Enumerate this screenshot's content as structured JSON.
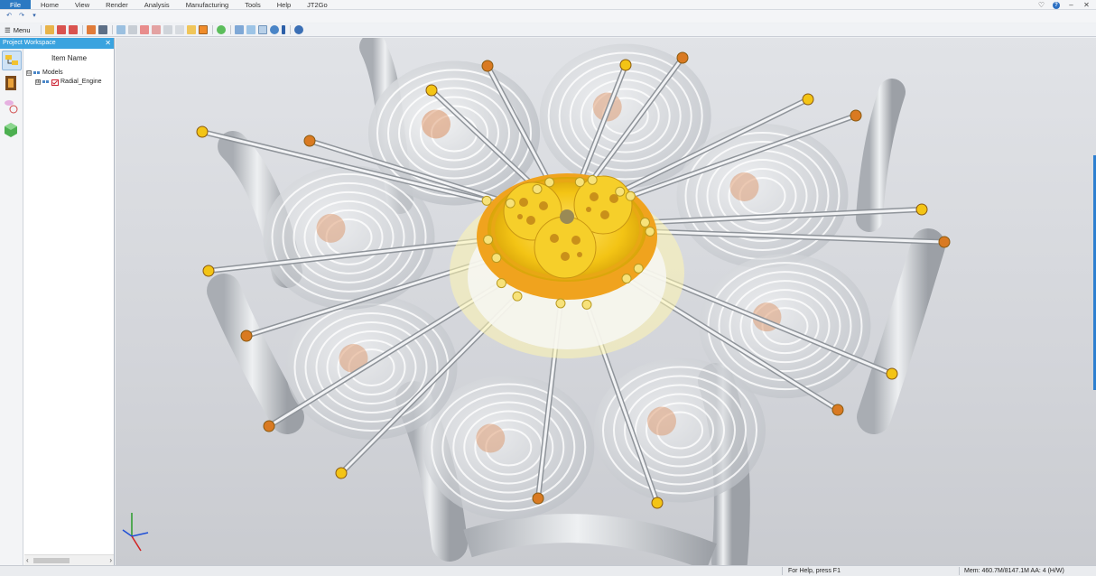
{
  "menubar": {
    "items": [
      "File",
      "Home",
      "View",
      "Render",
      "Analysis",
      "Manufacturing",
      "Tools",
      "Help",
      "JT2Go"
    ]
  },
  "toolbar": {
    "menu_label": "Menu"
  },
  "workspace": {
    "title": "Project Workspace",
    "column_header": "Item Name",
    "tree": [
      {
        "label": "Models",
        "expand": "⊟"
      },
      {
        "label": "Radial_Engine",
        "expand": "⊞"
      }
    ]
  },
  "status": {
    "help_text": "For Help, press F1",
    "memory_text": "Mem: 460.7M/8147.1M  AA: 4 (H/W)"
  },
  "colors": {
    "accent": "#2b79c2",
    "panel_title": "#3aa3df",
    "part_yellow": "#f3c415",
    "part_orange": "#d97a22"
  },
  "icons": [
    "undo-icon",
    "redo-icon",
    "dropdown-icon",
    "menu-icon",
    "minimize-icon",
    "help-icon",
    "close-icon",
    "triad-icon"
  ]
}
